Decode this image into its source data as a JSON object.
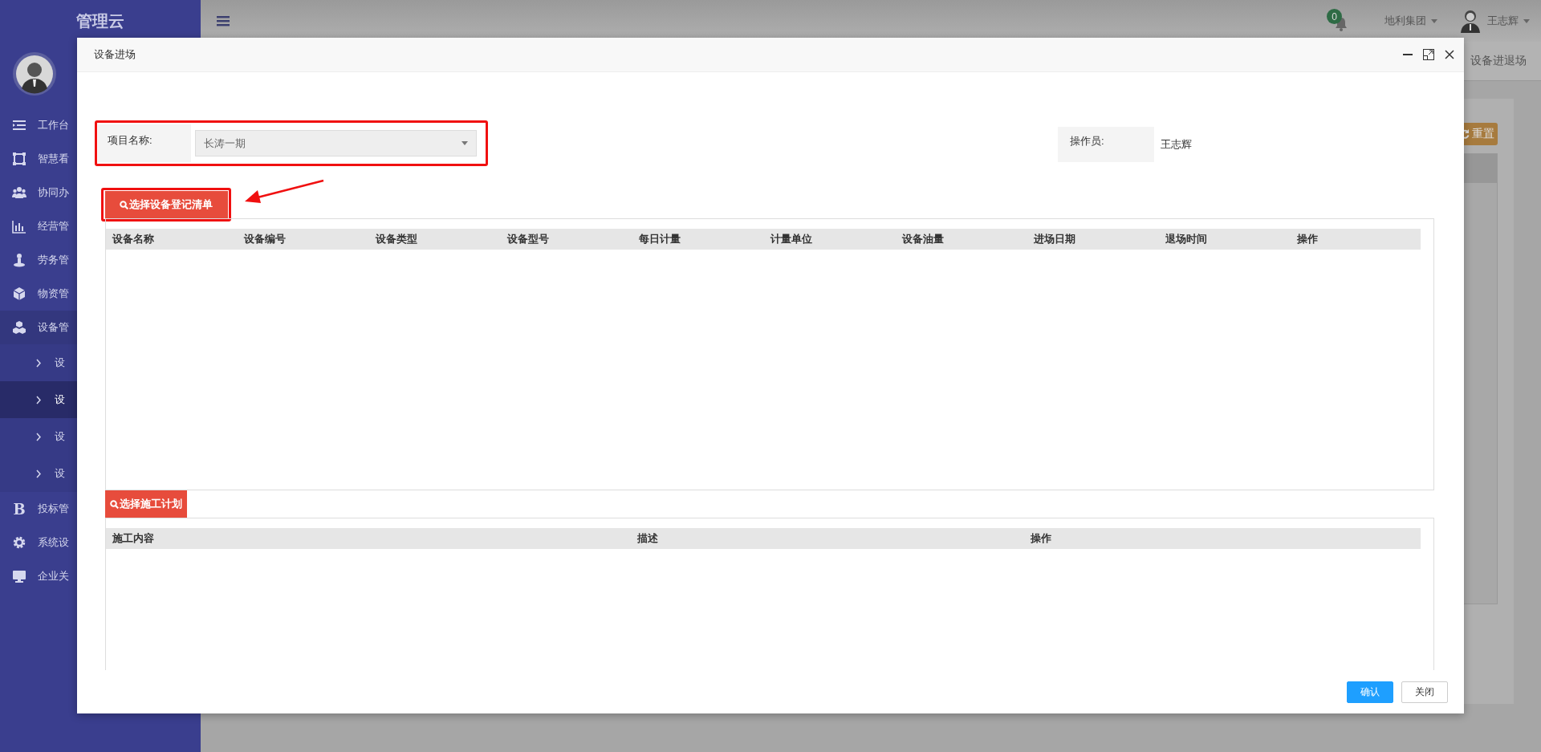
{
  "sidebar": {
    "logo": "管理云",
    "items": [
      {
        "label": "工作台",
        "selected": false
      },
      {
        "label": "智慧看",
        "selected": false
      },
      {
        "label": "协同办",
        "selected": false
      },
      {
        "label": "经营管",
        "selected": false
      },
      {
        "label": "劳务管",
        "selected": false
      },
      {
        "label": "物资管",
        "selected": false
      },
      {
        "label": "设备管",
        "selected": true,
        "children": [
          {
            "label": "设",
            "selected": false
          },
          {
            "label": "设",
            "selected": true
          },
          {
            "label": "设",
            "selected": false
          },
          {
            "label": "设",
            "selected": false
          }
        ]
      },
      {
        "label": "投标管",
        "selected": false,
        "glyph": "B"
      },
      {
        "label": "系统设",
        "selected": false
      },
      {
        "label": "企业关",
        "selected": false
      }
    ]
  },
  "top_bar": {
    "notifications": "0",
    "organization": "地利集团",
    "user": "王志辉"
  },
  "background": {
    "tab": "设备进退场",
    "reset_button": "重置"
  },
  "dialog": {
    "title": "设备进场",
    "project": {
      "label": "项目名称:",
      "value": "长涛一期"
    },
    "operator": {
      "label": "操作员:",
      "value": "王志辉"
    },
    "equipment_button": "选择设备登记清单",
    "equipment_table": {
      "columns": [
        "设备名称",
        "设备编号",
        "设备类型",
        "设备型号",
        "每日计量",
        "计量单位",
        "设备油量",
        "进场日期",
        "退场时间",
        "操作"
      ]
    },
    "plan_button": "选择施工计划",
    "plan_table": {
      "columns": [
        "施工内容",
        "描述",
        "操作"
      ]
    },
    "buttons": [
      {
        "label": "确认",
        "kind": "primary"
      },
      {
        "label": "关闭",
        "kind": "default"
      }
    ]
  }
}
